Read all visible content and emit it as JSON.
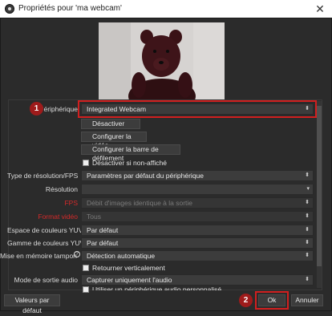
{
  "window": {
    "title": "Propriétés pour 'ma webcam'",
    "close_label": "✕"
  },
  "annotations": {
    "badge1": "1",
    "badge2": "2"
  },
  "properties": {
    "peripherique": {
      "label": "Périphérique",
      "value": "Integrated Webcam"
    },
    "deactivate": "Désactiver",
    "configure_video": "Configurer la vidéo",
    "configure_crossbar": "Configurer la barre de défilement",
    "deactivate_when_hidden": "Désactiver si non-affiché",
    "resolution_type": {
      "label": "Type de résolution/FPS",
      "value": "Paramètres par défaut du périphérique"
    },
    "resolution": {
      "label": "Résolution",
      "value": ""
    },
    "fps": {
      "label": "FPS",
      "value": "Débit d'images identique à la sortie"
    },
    "video_format": {
      "label": "Format vidéo",
      "value": "Tous"
    },
    "color_space": {
      "label": "Espace de couleurs YUV",
      "value": "Par défaut"
    },
    "color_range": {
      "label": "Gamme de couleurs YUV",
      "value": "Par défaut"
    },
    "buffering": {
      "label": "Mise en mémoire tampon",
      "value": "Détection automatique"
    },
    "flip_vertical": "Retourner verticalement",
    "audio_output": {
      "label": "Mode de sortie audio",
      "value": "Capturer uniquement l'audio"
    },
    "custom_audio": "Utiliser un périphérique audio personnalisé"
  },
  "footer": {
    "defaults": "Valeurs par défaut",
    "ok": "Ok",
    "cancel": "Annuler"
  },
  "colors": {
    "accent_red": "#d11f1f",
    "badge_red": "#9e1b1b",
    "background": "#2b2b2b"
  }
}
